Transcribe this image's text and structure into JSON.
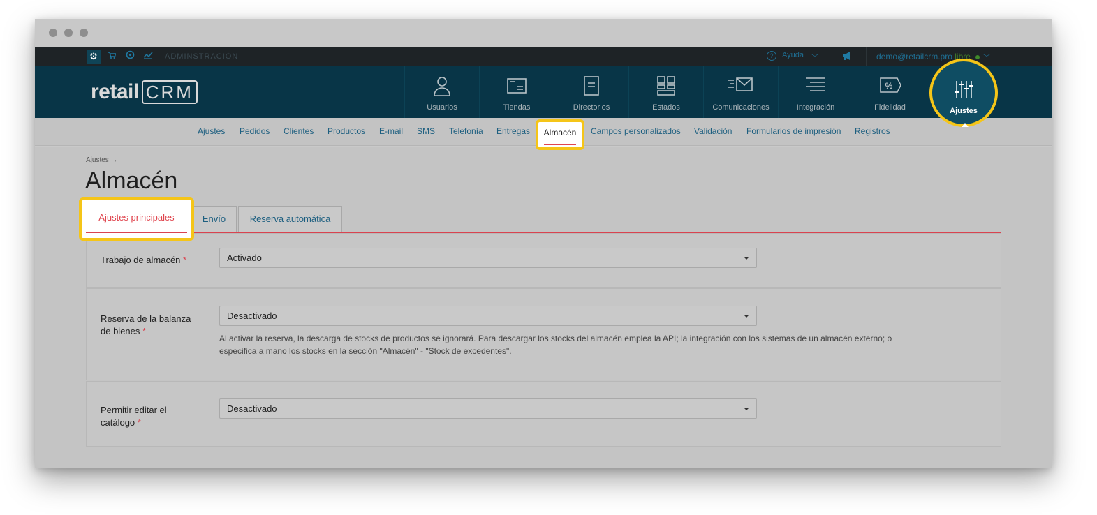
{
  "topbar": {
    "admin_label": "ADMINSTRACIÓN",
    "help_label": "Ayuda",
    "user_email": "demo@retailcrm.pro",
    "user_plan": "libre"
  },
  "brand": {
    "name": "retail",
    "suffix": "CRM"
  },
  "mainnav": {
    "items": [
      {
        "label": "Usuarios",
        "icon": "user-icon"
      },
      {
        "label": "Tiendas",
        "icon": "store-icon"
      },
      {
        "label": "Directorios",
        "icon": "document-icon"
      },
      {
        "label": "Estados",
        "icon": "grid-icon"
      },
      {
        "label": "Comunicaciones",
        "icon": "envelope-icon"
      },
      {
        "label": "Integración",
        "icon": "lines-icon"
      },
      {
        "label": "Fidelidad",
        "icon": "percent-tag-icon"
      }
    ],
    "active": {
      "label": "Ajustes",
      "icon": "sliders-icon"
    }
  },
  "subnav": {
    "items": [
      "Ajustes",
      "Pedidos",
      "Clientes",
      "Productos",
      "E-mail",
      "SMS",
      "Telefonía",
      "Entregas",
      "Almacén",
      "Campos personalizados",
      "Validación",
      "Formularios de impresión",
      "Registros"
    ],
    "active": "Almacén"
  },
  "page": {
    "breadcrumb": "Ajustes →",
    "title": "Almacén"
  },
  "tabs": {
    "active": "Ajustes principales",
    "others": [
      "Envío",
      "Reserva automática"
    ]
  },
  "fields": {
    "warehouse": {
      "label": "Trabajo de almacén",
      "required": "*",
      "value": "Activado"
    },
    "reserve": {
      "label_line1": "Reserva de la balanza",
      "label_line2": "de bienes",
      "required": "*",
      "value": "Desactivado",
      "hint_line1": "Al activar la reserva, la descarga de stocks de productos se ignorará. Para descargar los stocks del almacén emplea la API; la integración con los sistemas de un almacén externo; o",
      "hint_line2": "especifica a mano los stocks en la sección \"Almacén\" - \"Stock de excedentes\"."
    },
    "catalog": {
      "label_line1": "Permitir editar el",
      "label_line2": "catálogo",
      "required": "*",
      "value": "Desactivado"
    }
  },
  "colors": {
    "accent": "#d9434f",
    "highlight": "#f5c518",
    "nav": "#083547",
    "link": "#1d5f80"
  }
}
